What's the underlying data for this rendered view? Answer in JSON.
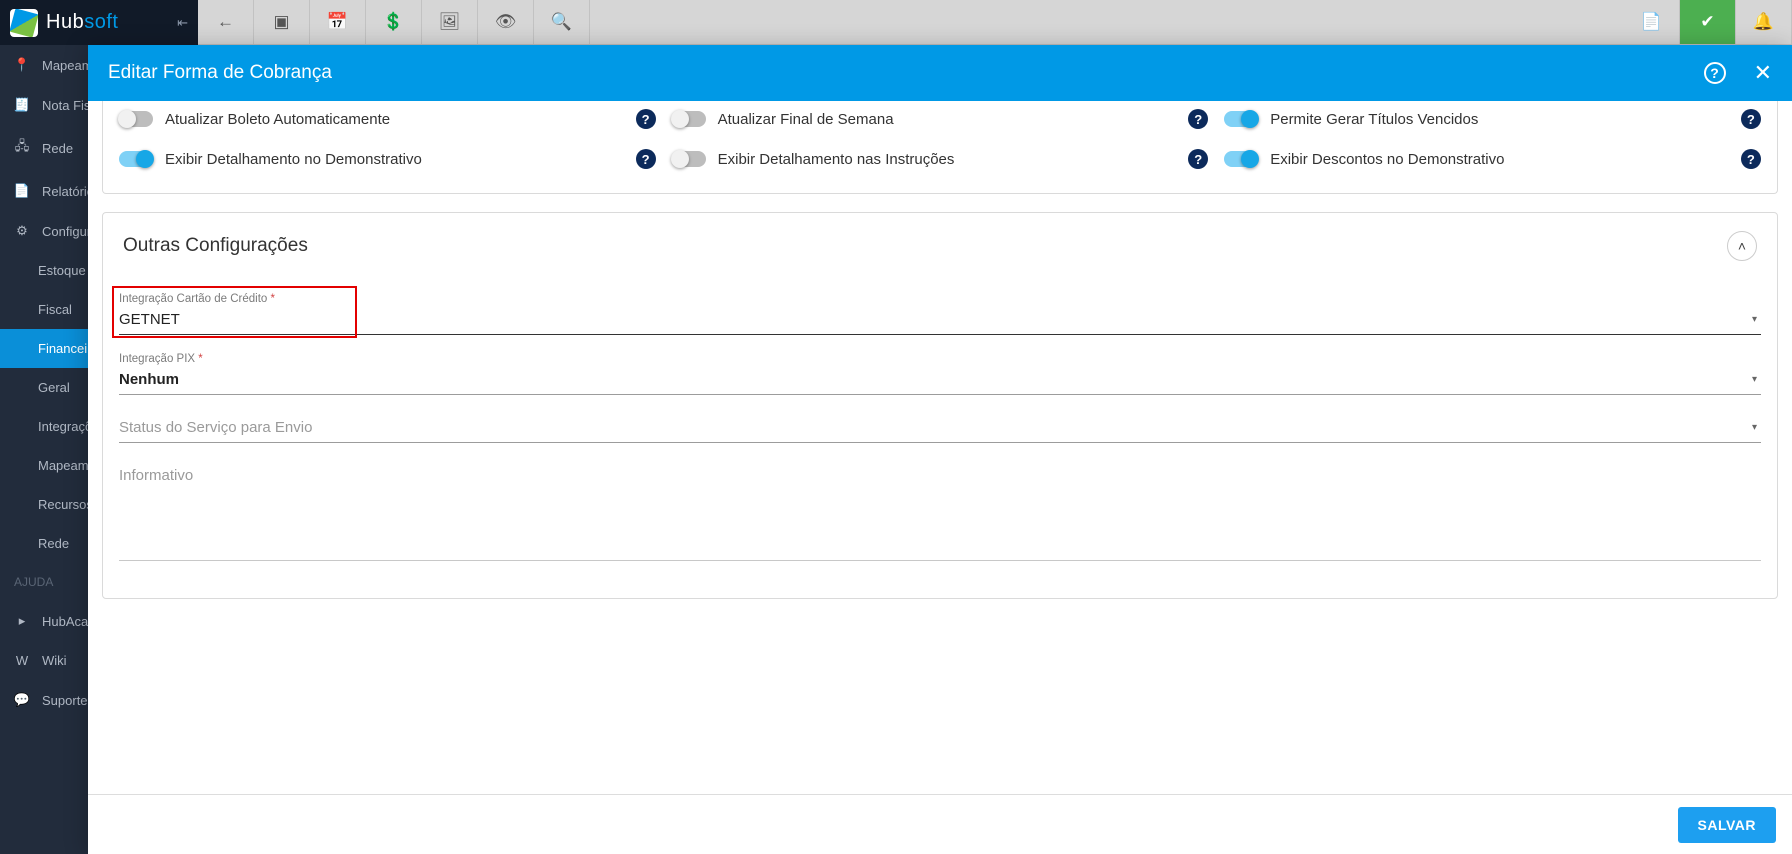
{
  "app": {
    "logo_hub": "Hub",
    "logo_soft": "soft"
  },
  "sidebar": {
    "items": [
      {
        "icon": "📍",
        "label": "Mapeamento"
      },
      {
        "icon": "📄",
        "label": "Nota Fiscal"
      },
      {
        "icon": "🖧",
        "label": "Rede"
      },
      {
        "icon": "📑",
        "label": "Relatórios"
      },
      {
        "icon": "⚙",
        "label": "Configurações"
      }
    ],
    "sub": [
      "Estoque",
      "Fiscal",
      "Financeiro",
      "Geral",
      "Integrações",
      "Mapeamento",
      "Recursos Humanos",
      "Rede"
    ],
    "active_sub_index": 2,
    "help_header": "AJUDA",
    "help": [
      {
        "icon": "▶",
        "label": "HubAcademy"
      },
      {
        "icon": "W",
        "label": "Wiki"
      },
      {
        "icon": "💬",
        "label": "Suporte"
      }
    ]
  },
  "modal": {
    "title": "Editar Forma de Cobrança",
    "save": "SALVAR"
  },
  "toggles": {
    "row1": [
      {
        "label": "Atualizar Boleto Automaticamente",
        "on": false
      },
      {
        "label": "Atualizar Final de Semana",
        "on": false
      },
      {
        "label": "Permite Gerar Títulos Vencidos",
        "on": true
      }
    ],
    "row2": [
      {
        "label": "Exibir Detalhamento no Demonstrativo",
        "on": true
      },
      {
        "label": "Exibir Detalhamento nas Instruções",
        "on": false
      },
      {
        "label": "Exibir Descontos no Demonstrativo",
        "on": true
      }
    ]
  },
  "other_config": {
    "title": "Outras Configurações",
    "cc_label": "Integração Cartão de Crédito",
    "cc_value": "GETNET",
    "pix_label": "Integração PIX",
    "pix_value": "Nenhum",
    "status_placeholder": "Status do Serviço para Envio",
    "info_placeholder": "Informativo"
  }
}
